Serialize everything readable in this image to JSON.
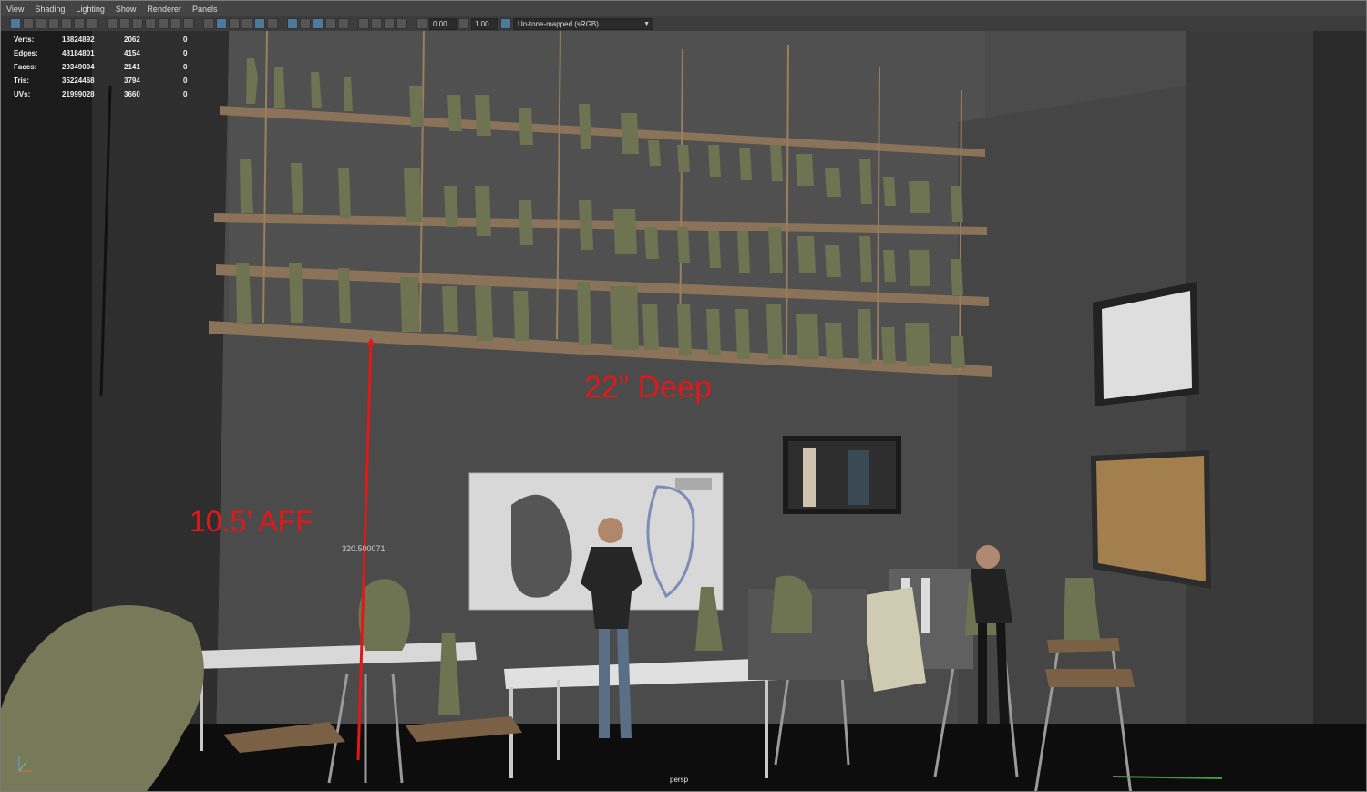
{
  "menu": [
    "View",
    "Shading",
    "Lighting",
    "Show",
    "Renderer",
    "Panels"
  ],
  "toolbar": {
    "exposure": "0.00",
    "gamma": "1.00",
    "color_space": "Un-tone-mapped (sRGB)"
  },
  "hud": {
    "rows": [
      {
        "label": "Verts:",
        "v1": "18824892",
        "v2": "2062",
        "v3": "0"
      },
      {
        "label": "Edges:",
        "v1": "48184801",
        "v2": "4154",
        "v3": "0"
      },
      {
        "label": "Faces:",
        "v1": "29349004",
        "v2": "2141",
        "v3": "0"
      },
      {
        "label": "Tris:",
        "v1": "35224468",
        "v2": "3794",
        "v3": "0"
      },
      {
        "label": "UVs:",
        "v1": "21999028",
        "v2": "3660",
        "v3": "0"
      }
    ]
  },
  "annotations": {
    "depth": "22” Deep",
    "height": "10.5’ AFF",
    "measure_value": "320.500071"
  },
  "camera": "persp",
  "colors": {
    "annotation": "#e01818",
    "wall": "#4a4a4a",
    "shelf": "#8a7359",
    "figure": "#6e7452"
  }
}
